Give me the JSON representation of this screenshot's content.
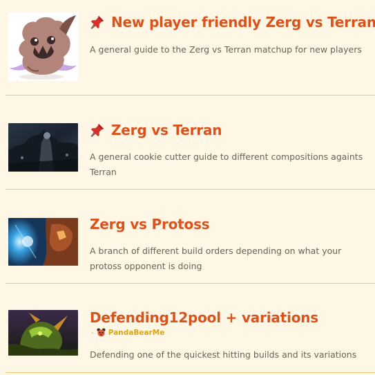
{
  "guides": [
    {
      "title": "New player friendly Zerg vs Terran",
      "description": "A general guide to the Zerg vs Terran matchup for new players",
      "pinned": true,
      "thumbnail_icon": "zerg-creature-cartoon-image"
    },
    {
      "title": "Zerg vs Terran",
      "description": "A general cookie cutter guide to different compositions againts Terran",
      "pinned": true,
      "thumbnail_icon": "zerg-vs-terran-art-image"
    },
    {
      "title": "Zerg vs Protoss",
      "description": "A branch of different build orders depending on what your protoss opponent is doing",
      "pinned": false,
      "thumbnail_icon": "zerg-vs-protoss-art-image"
    },
    {
      "title": "Defending12pool + variations",
      "author": "PandaBearMe",
      "description": "Defending one of the quickest hitting builds and its variations",
      "pinned": false,
      "thumbnail_icon": "zerg-hydralisk-art-image"
    }
  ],
  "colors": {
    "background": "#fff7e5",
    "title": "#d9531e",
    "description": "#6a6258",
    "divider": "#f0c87a",
    "author": "#d6a51a"
  }
}
